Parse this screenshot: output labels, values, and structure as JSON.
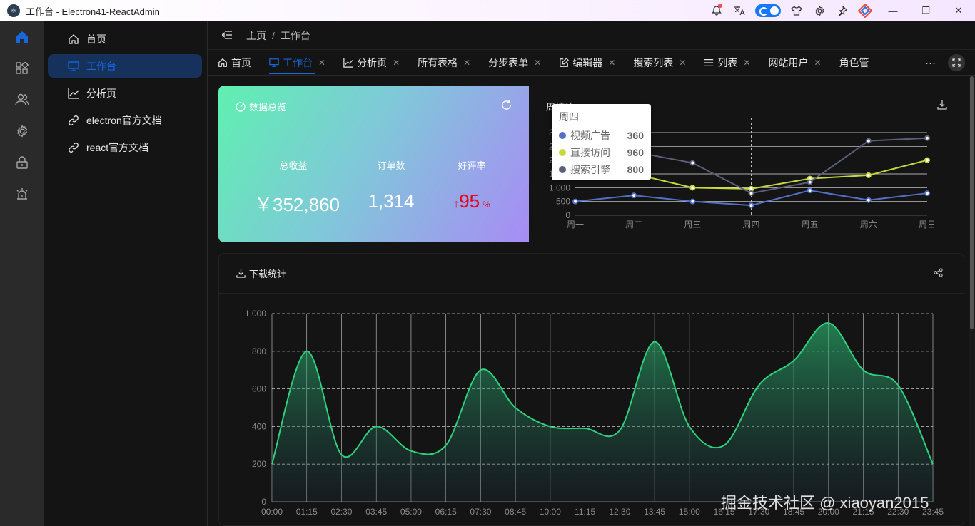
{
  "window": {
    "title": "工作台 - Electron41-ReactAdmin"
  },
  "header": {
    "breadcrumb": [
      "主页",
      "工作台"
    ]
  },
  "menu": {
    "items": [
      {
        "label": "首页",
        "icon": "home-icon"
      },
      {
        "label": "工作台",
        "icon": "desktop-icon",
        "active": true
      },
      {
        "label": "分析页",
        "icon": "line-chart-icon"
      },
      {
        "label": "electron官方文档",
        "icon": "link-icon"
      },
      {
        "label": "react官方文档",
        "icon": "link-icon"
      }
    ]
  },
  "rail": {
    "icons": [
      "home-icon",
      "apps-icon",
      "team-icon",
      "settings-icon",
      "lock-icon",
      "alarm-icon"
    ]
  },
  "tabs": [
    {
      "label": "首页",
      "icon": "home-icon",
      "closable": false
    },
    {
      "label": "工作台",
      "icon": "desktop-icon",
      "closable": true,
      "active": true
    },
    {
      "label": "分析页",
      "icon": "line-chart-icon",
      "closable": true
    },
    {
      "label": "所有表格",
      "icon": "",
      "closable": true
    },
    {
      "label": "分步表单",
      "icon": "",
      "closable": true
    },
    {
      "label": "编辑器",
      "icon": "edit-icon",
      "closable": true
    },
    {
      "label": "搜索列表",
      "icon": "",
      "closable": true
    },
    {
      "label": "列表",
      "icon": "list-icon",
      "closable": true
    },
    {
      "label": "网站用户",
      "icon": "",
      "closable": true
    },
    {
      "label": "角色管",
      "icon": "",
      "closable": false
    }
  ],
  "overview": {
    "title": "数据总览",
    "stats": [
      {
        "label": "总收益",
        "value": "￥352,860"
      },
      {
        "label": "订单数",
        "value": "1,314"
      },
      {
        "label": "好评率",
        "value": "95",
        "unit": "%",
        "trend": "up"
      }
    ]
  },
  "week_card": {
    "title": "周统计"
  },
  "download_card": {
    "title": "下载统计"
  },
  "tooltip": {
    "title": "周四",
    "rows": [
      {
        "name": "视频广告",
        "value": "360",
        "color": "#5470c6"
      },
      {
        "name": "直接访问",
        "value": "960",
        "color": "#c8d93b"
      },
      {
        "name": "搜索引擎",
        "value": "800",
        "color": "#5b5f7a"
      }
    ]
  },
  "watermark": "掘金技术社区 @ xiaoyan2015",
  "colors": {
    "accent": "#1668dc",
    "green_line": "#2fd07f"
  },
  "chart_data": [
    {
      "type": "line",
      "categories": [
        "周一",
        "周二",
        "周三",
        "周四",
        "周五",
        "周六",
        "周日"
      ],
      "ylim": [
        0,
        3000
      ],
      "yticks": [
        "0",
        "500",
        "1,000",
        "1,500",
        "2,000",
        "2,500",
        "3,000"
      ],
      "grid": true,
      "series": [
        {
          "name": "视频广告",
          "color": "#5470c6",
          "values": [
            500,
            720,
            500,
            360,
            900,
            550,
            800
          ]
        },
        {
          "name": "直接访问",
          "color": "#c8d93b",
          "values": [
            1500,
            1500,
            1000,
            960,
            1330,
            1450,
            2000
          ]
        },
        {
          "name": "搜索引擎",
          "color": "#5b5f7a",
          "values": [
            2000,
            2300,
            1900,
            800,
            1200,
            2700,
            2800
          ]
        }
      ]
    },
    {
      "type": "area",
      "categories": [
        "00:00",
        "01:15",
        "02:30",
        "03:45",
        "05:00",
        "06:15",
        "07:30",
        "08:45",
        "10:00",
        "11:15",
        "12:30",
        "13:45",
        "15:00",
        "16:15",
        "17:30",
        "18:45",
        "20:00",
        "21:15",
        "22:30",
        "23:45"
      ],
      "values": [
        200,
        800,
        250,
        400,
        270,
        300,
        700,
        500,
        400,
        390,
        380,
        850,
        400,
        300,
        620,
        750,
        950,
        700,
        620,
        200
      ],
      "ylim": [
        0,
        1000
      ],
      "yticks": [
        "0",
        "200",
        "400",
        "600",
        "800",
        "1,000"
      ],
      "grid": true,
      "color": "#2fd07f"
    }
  ]
}
